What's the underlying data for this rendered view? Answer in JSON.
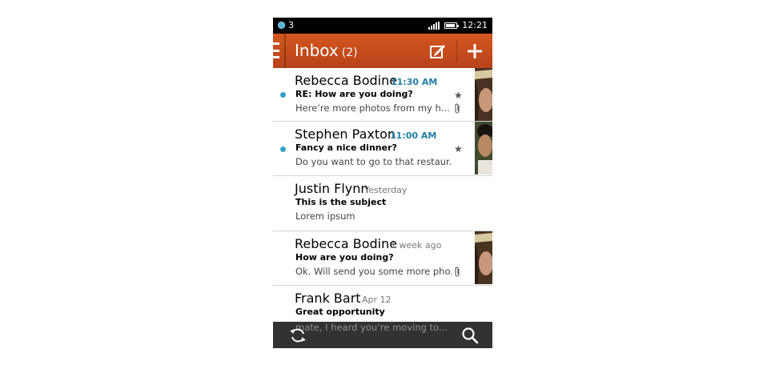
{
  "status_bar": {
    "notification_count": "3",
    "time": "12:21",
    "icons": [
      "notification-icon",
      "signal-icon",
      "battery-icon"
    ]
  },
  "header": {
    "title": "Inbox",
    "unread_count": "(2)",
    "icons": [
      "menu-icon",
      "compose-icon",
      "add-icon"
    ],
    "color": "#c94d1c"
  },
  "messages": [
    {
      "sender": "Rebecca Bodine",
      "time": "11:30 AM",
      "subject": "RE: How are you doing?",
      "preview": "Here’re more photos from my h...",
      "unread": true,
      "starred": true,
      "attachment": true,
      "avatar": "avatar-rebecca"
    },
    {
      "sender": "Stephen Paxton",
      "time": "11:00 AM",
      "subject": "Fancy a nice dinner?",
      "preview": "Do you want to go to that restaur...",
      "unread": true,
      "starred": true,
      "attachment": false,
      "avatar": "avatar-stephen"
    },
    {
      "sender": "Justin Flynn",
      "time": "Yesterday",
      "subject": "This is the subject",
      "preview": "Lorem ipsum",
      "unread": false,
      "starred": false,
      "attachment": false,
      "avatar": ""
    },
    {
      "sender": "Rebecca Bodine",
      "time": "1 week ago",
      "subject": "How are you doing?",
      "preview": "Ok. Will send you some more pho...",
      "unread": false,
      "starred": false,
      "attachment": true,
      "avatar": "avatar-rebecca"
    },
    {
      "sender": "Frank Bart",
      "time": "Apr 12",
      "subject": "Great opportunity",
      "preview": "mate, I heard you’re moving to...",
      "unread": false,
      "starred": false,
      "attachment": false,
      "avatar": ""
    }
  ],
  "bottom_bar": {
    "icons": [
      "refresh-icon",
      "search-icon"
    ]
  },
  "colors": {
    "accent_blue": "#34a4c9",
    "time_blue": "#1e7fa6"
  }
}
